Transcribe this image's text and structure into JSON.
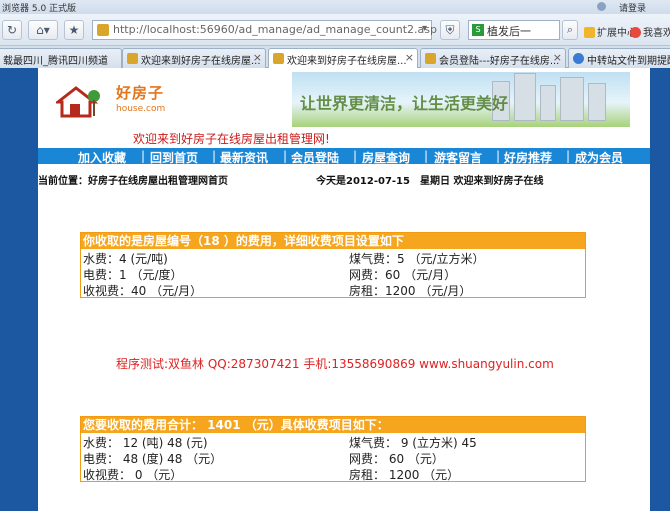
{
  "browser": {
    "title": "浏览器 5.0 正式版",
    "login": "请登录",
    "url": "http://localhost:56960/ad_manage/ad_manage_count2.asp",
    "search_text": "植发后一",
    "extensions": [
      "扩展中心",
      "我喜欢"
    ],
    "tabs": [
      {
        "label": "载最四川_腾讯四川频道"
      },
      {
        "label": "欢迎来到好房子在线房屋..."
      },
      {
        "label": "欢迎来到好房子在线房屋..."
      },
      {
        "label": "会员登陆---好房子在线房..."
      },
      {
        "label": "中转站文件到期提醒"
      }
    ]
  },
  "site": {
    "logo_name": "好房子",
    "logo_domain": "house.com",
    "banner_slogan": "让世界更清洁，让生活更美好",
    "welcome": "欢迎来到好房子在线房屋出租管理网!",
    "menu": [
      "加入收藏",
      "回到首页",
      "最新资讯",
      "会员登陆",
      "房屋查询",
      "游客留言",
      "好房推荐",
      "成为会员"
    ],
    "location": "当前位置：好房子在线房屋出租管理网首页",
    "today": "今天是2012-07-15　星期日 欢迎来到好房子在线"
  },
  "fees": {
    "header": "你收取的是房屋编号（18 ）的费用，详细收费项目设置如下",
    "rows": [
      [
        "水费：4 (元/吨)",
        "煤气费：5 （元/立方米）"
      ],
      [
        "电费：1 （元/度）",
        "网费：60 （元/月）"
      ],
      [
        "收视费：40 （元/月）",
        "房租：1200 （元/月）"
      ]
    ]
  },
  "tester": "程序测试:双鱼林 QQ:287307421 手机:13558690869 www.shuangyulin.com",
  "totals": {
    "header": "您要收取的费用合计： 1401 （元）具体收费项目如下：",
    "rows": [
      [
        "水费： 12 (吨) 48 (元)",
        "煤气费： 9 (立方米) 45"
      ],
      [
        "电费： 48 (度) 48 （元）",
        "网费： 60 （元）"
      ],
      [
        "收视费： 0 （元）",
        "房租： 1200 （元）"
      ]
    ]
  },
  "colors": {
    "page_bg": "#1c57a2",
    "menu_bg": "#1a86d6",
    "box_header": "#f6a51e",
    "welcome_red": "#cc1a1a"
  }
}
